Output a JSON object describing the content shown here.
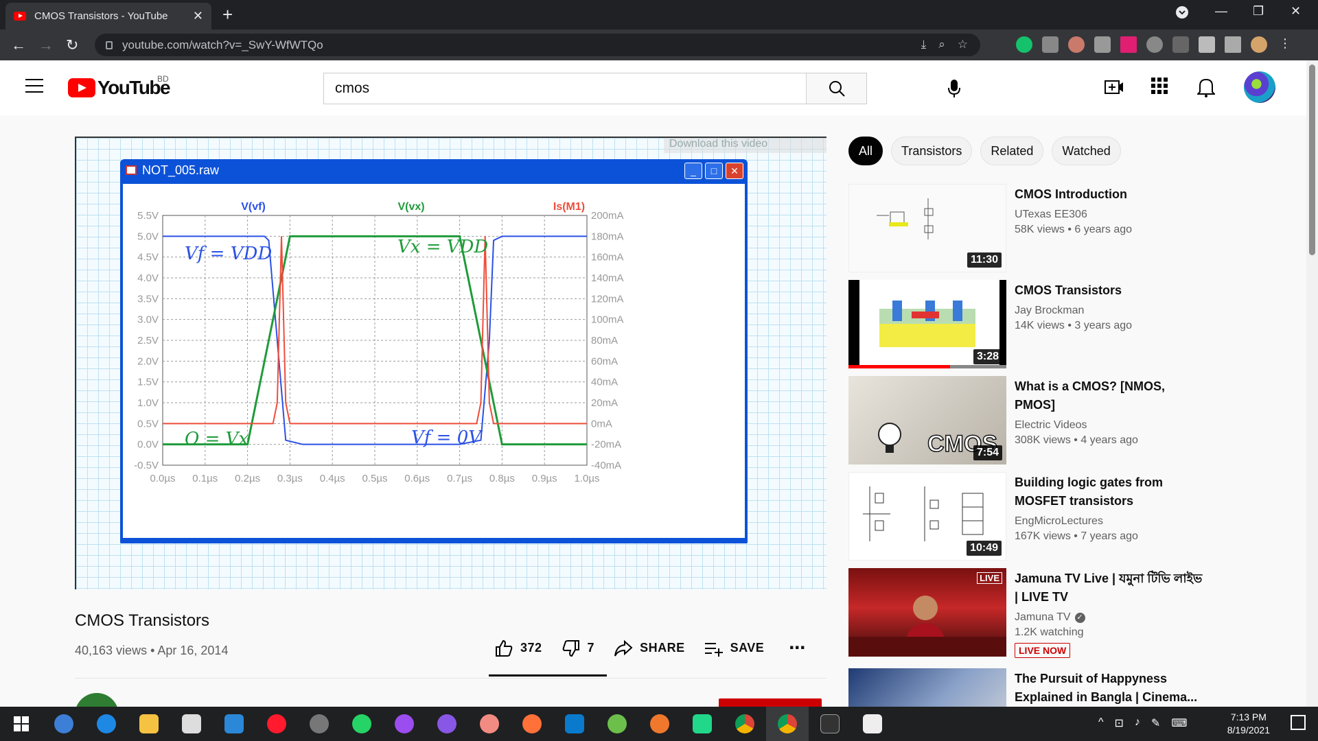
{
  "browser": {
    "tab_title": "CMOS Transistors - YouTube",
    "url": "youtube.com/watch?v=_SwY-WfWTQo"
  },
  "header": {
    "logo_text": "YouTube",
    "region": "BD",
    "search_value": "cmos"
  },
  "player": {
    "download_banner": "Download this video",
    "window_title": "NOT_005.raw"
  },
  "chart_data": {
    "type": "line",
    "title": "",
    "series_labels": [
      "V(vf)",
      "V(vx)",
      "Is(M1)"
    ],
    "x_ticks": [
      "0.0µs",
      "0.1µs",
      "0.2µs",
      "0.3µs",
      "0.4µs",
      "0.5µs",
      "0.6µs",
      "0.7µs",
      "0.8µs",
      "0.9µs",
      "1.0µs"
    ],
    "y_left_ticks": [
      "5.5V",
      "5.0V",
      "4.5V",
      "4.0V",
      "3.5V",
      "3.0V",
      "2.5V",
      "2.0V",
      "1.5V",
      "1.0V",
      "0.5V",
      "0.0V",
      "-0.5V"
    ],
    "y_right_ticks": [
      "200mA",
      "180mA",
      "160mA",
      "140mA",
      "120mA",
      "100mA",
      "80mA",
      "60mA",
      "40mA",
      "20mA",
      "0mA",
      "-20mA",
      "-40mA"
    ],
    "xlim": [
      0,
      1.0
    ],
    "ylim": [
      -0.5,
      5.5
    ],
    "grid": true,
    "colors": {
      "vf": "#2a50e6",
      "vx": "#1f9b3a",
      "is": "#ee4d3b"
    },
    "series": [
      {
        "name": "V(vf)",
        "x": [
          0.0,
          0.24,
          0.25,
          0.27,
          0.29,
          0.33,
          0.7,
          0.75,
          0.77,
          0.78,
          0.8,
          1.0
        ],
        "y": [
          5.0,
          5.0,
          4.9,
          2.5,
          0.1,
          0.0,
          0.0,
          0.1,
          2.5,
          4.9,
          5.0,
          5.0
        ]
      },
      {
        "name": "V(vx)",
        "x": [
          0.0,
          0.2,
          0.3,
          0.7,
          0.8,
          1.0
        ],
        "y": [
          0.0,
          0.0,
          5.0,
          5.0,
          0.0,
          0.0
        ]
      },
      {
        "name": "Is(M1)",
        "x": [
          0.0,
          0.26,
          0.27,
          0.28,
          0.29,
          0.3,
          0.74,
          0.75,
          0.76,
          0.77,
          0.78,
          1.0
        ],
        "y": [
          0.0,
          0.0,
          20,
          180,
          20,
          0.0,
          0.0,
          20,
          180,
          20,
          0.0,
          0.0
        ]
      }
    ],
    "annotations": [
      "Vf = VDD",
      "Vx = VDD",
      "O = Vx",
      "Vf = 0V"
    ]
  },
  "video": {
    "title": "CMOS Transistors",
    "stats": "40,163 views • Apr 16, 2014",
    "likes": "372",
    "dislikes": "7",
    "share_label": "SHARE",
    "save_label": "SAVE"
  },
  "chips": [
    "All",
    "Transistors",
    "Related",
    "Watched"
  ],
  "recommendations": [
    {
      "title": "CMOS Introduction",
      "channel": "UTexas EE306",
      "meta": "58K views • 6 years ago",
      "duration": "11:30"
    },
    {
      "title": "CMOS Transistors",
      "channel": "Jay Brockman",
      "meta": "14K views • 3 years ago",
      "duration": "3:28",
      "progress": 0.64
    },
    {
      "title": "What is a CMOS? [NMOS, PMOS]",
      "channel": "Electric Videos",
      "meta": "308K views • 4 years ago",
      "duration": "7:54"
    },
    {
      "title": "Building logic gates from MOSFET transistors",
      "channel": "EngMicroLectures",
      "meta": "167K views • 7 years ago",
      "duration": "10:49"
    },
    {
      "title": "Jamuna TV Live | যমুনা টিভি লাইভ | LIVE TV",
      "channel": "Jamuna TV",
      "meta": "1.2K watching",
      "badge": "LIVE NOW",
      "live": "LIVE"
    },
    {
      "title": "The Pursuit of Happyness Explained in Bangla | Cinema..."
    }
  ],
  "taskbar": {
    "time": "7:13 PM",
    "date": "8/19/2021"
  }
}
